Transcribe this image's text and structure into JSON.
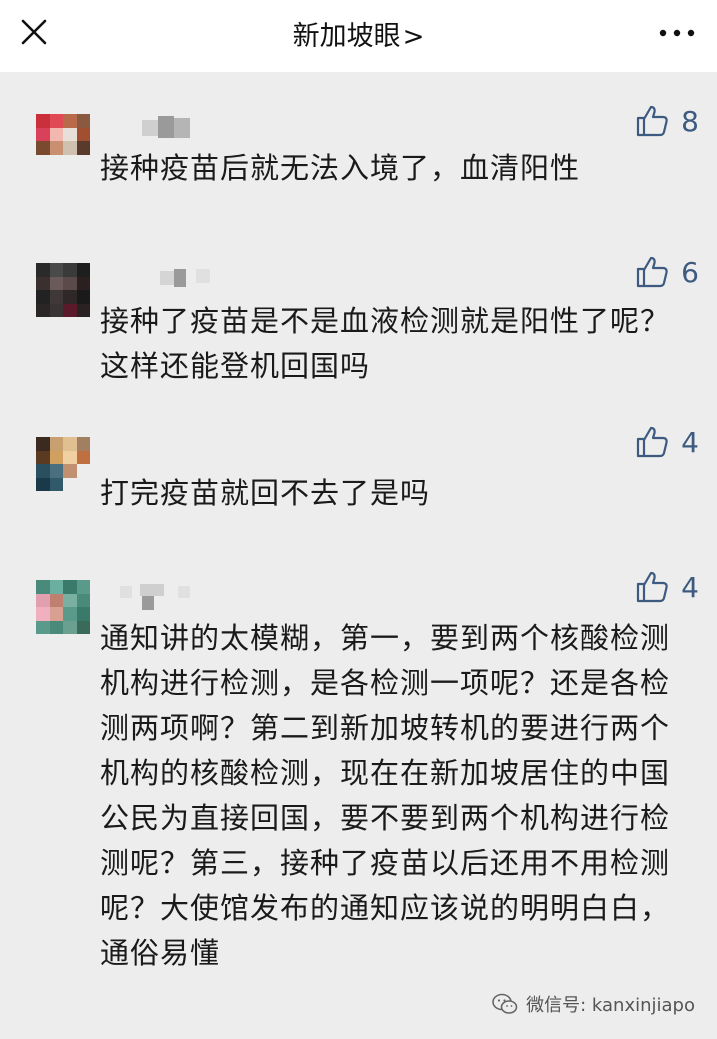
{
  "header": {
    "title": "新加坡眼",
    "title_chevron": ">",
    "close_icon": "close-icon",
    "more_icon": "more-icon"
  },
  "comments": [
    {
      "likes": "8",
      "text": "接种疫苗后就无法入境了，血清阳性"
    },
    {
      "likes": "6",
      "text": "接种了疫苗是不是血液检测就是阳性了呢？这样还能登机回国吗"
    },
    {
      "likes": "4",
      "text": "打完疫苗就回不去了是吗"
    },
    {
      "likes": "4",
      "text": "通知讲的太模糊，第一，要到两个核酸检测机构进行检测，是各检测一项呢？还是各检测两项啊？第二到新加坡转机的要进行两个机构的核酸检测，现在在新加坡居住的中国公民为直接回国，要不要到两个机构进行检测呢？第三，接种了疫苗以后还用不用检测呢？大使馆发布的通知应该说的明明白白，通俗易懂"
    }
  ],
  "watermark": {
    "text": "微信号: kanxinjiapo",
    "icon": "wechat-icon"
  },
  "colors": {
    "background": "#ededed",
    "header": "#ffffff",
    "like": "#3d5a80",
    "text": "#1a1a1a"
  }
}
